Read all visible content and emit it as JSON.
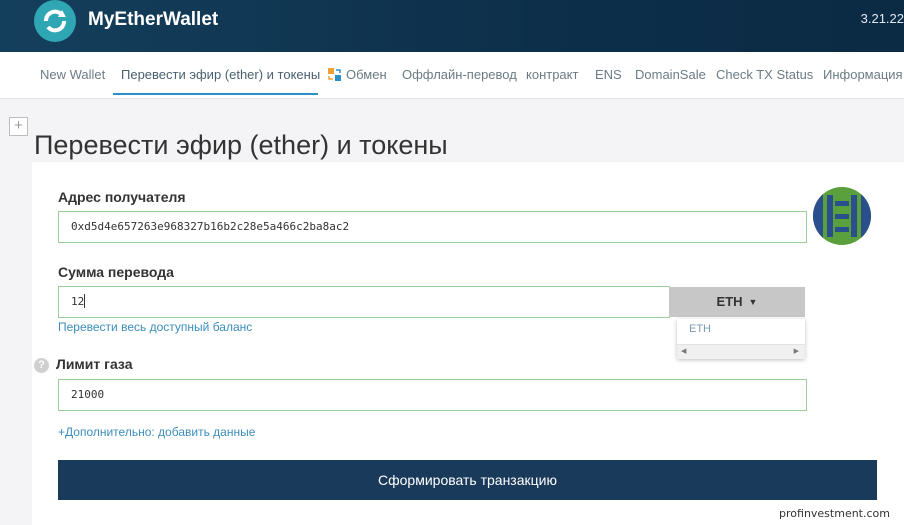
{
  "header": {
    "brand": "MyEtherWallet",
    "version": "3.21.22"
  },
  "nav": {
    "items": [
      {
        "label": "New Wallet"
      },
      {
        "label": "Перевести эфир (ether) и токены"
      },
      {
        "label": "Обмен",
        "icon": "swap-icon"
      },
      {
        "label": "Оффлайн-перевод"
      },
      {
        "label": "контракт"
      },
      {
        "label": "ENS"
      },
      {
        "label": "DomainSale"
      },
      {
        "label": "Check TX Status"
      },
      {
        "label": "Информация о"
      }
    ],
    "active_index": 1
  },
  "page": {
    "title": "Перевести эфир (ether) и токены",
    "expand_symbol": "+"
  },
  "form": {
    "recipient_label": "Адрес получателя",
    "recipient_value": "0xd5d4e657263e968327b16b2c28e5a466c2ba8ac2",
    "amount_label": "Сумма перевода",
    "amount_value": "12",
    "currency": "ETH",
    "currency_options": [
      "ETH"
    ],
    "send_all_link": "Перевести весь доступный баланс",
    "gas_label": "Лимит газа",
    "gas_help": "?",
    "gas_value": "21000",
    "advanced_link": "+Дополнительно: добавить данные",
    "submit_label": "Сформировать транзакцию"
  },
  "colors": {
    "header_bg": "#0d2f4a",
    "accent": "#3c8dbc",
    "field_border": "#9ccf9a",
    "submit_bg": "#1a3a5c"
  },
  "watermark": "profinvestment.com"
}
